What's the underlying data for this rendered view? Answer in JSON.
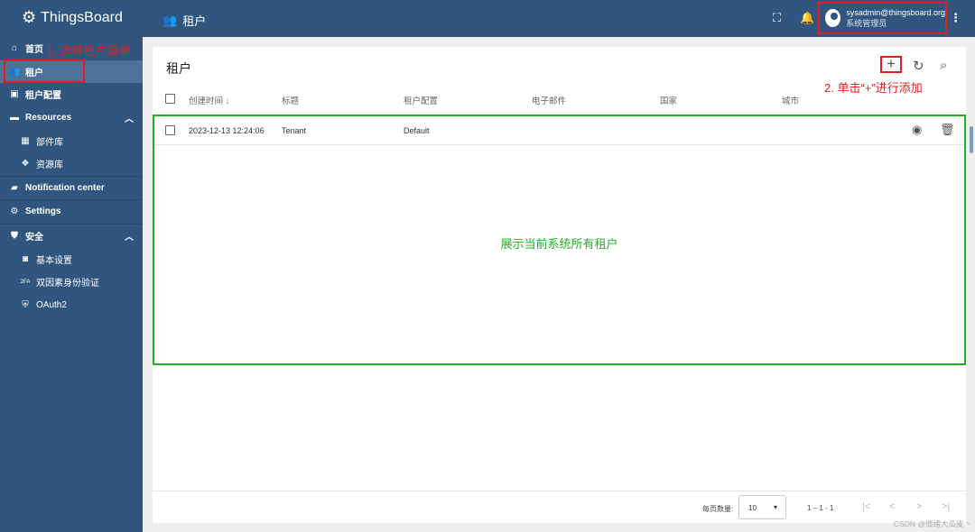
{
  "app": {
    "name": "ThingsBoard"
  },
  "header": {
    "title": "租户",
    "user_email": "sysadmin@thingsboard.org",
    "user_role": "系统管理员"
  },
  "sidebar": {
    "items": [
      {
        "label": "首页",
        "icon": "home-icon"
      },
      {
        "label": "租户",
        "icon": "users-icon",
        "active": true
      },
      {
        "label": "租户配置",
        "icon": "tenant-profile-icon"
      },
      {
        "label": "Resources",
        "icon": "folder-icon"
      },
      {
        "label": "部件库",
        "icon": "widgets-icon"
      },
      {
        "label": "资源库",
        "icon": "resources-icon"
      },
      {
        "label": "Notification center",
        "icon": "notification-icon"
      },
      {
        "label": "Settings",
        "icon": "gear-icon"
      },
      {
        "label": "安全",
        "icon": "shield-icon"
      },
      {
        "label": "基本设置",
        "icon": "settings-icon"
      },
      {
        "label": "双因素身份验证",
        "icon": "2fa-icon"
      },
      {
        "label": "OAuth2",
        "icon": "oauth-icon"
      }
    ]
  },
  "annotations": {
    "step1": "1. 选择租户菜单",
    "step2": "2. 单击“+”进行添加",
    "area": "展示当前系统所有租户"
  },
  "table": {
    "title": "租户",
    "columns": [
      "创建时间",
      "标题",
      "租户配置",
      "电子邮件",
      "国家",
      "城市"
    ],
    "rows": [
      {
        "created": "2023-12-13 12:24:06",
        "title": "Tenant",
        "profile": "Default"
      }
    ]
  },
  "pagination": {
    "page_size_label": "每页数量:",
    "page_size": "10",
    "range": "1 – 1 - 1"
  },
  "watermark": "CSDN @情绪大瓜皮丶",
  "colors": {
    "primary": "#305680",
    "annotation_red": "#e02020",
    "annotation_green": "#22b022"
  }
}
